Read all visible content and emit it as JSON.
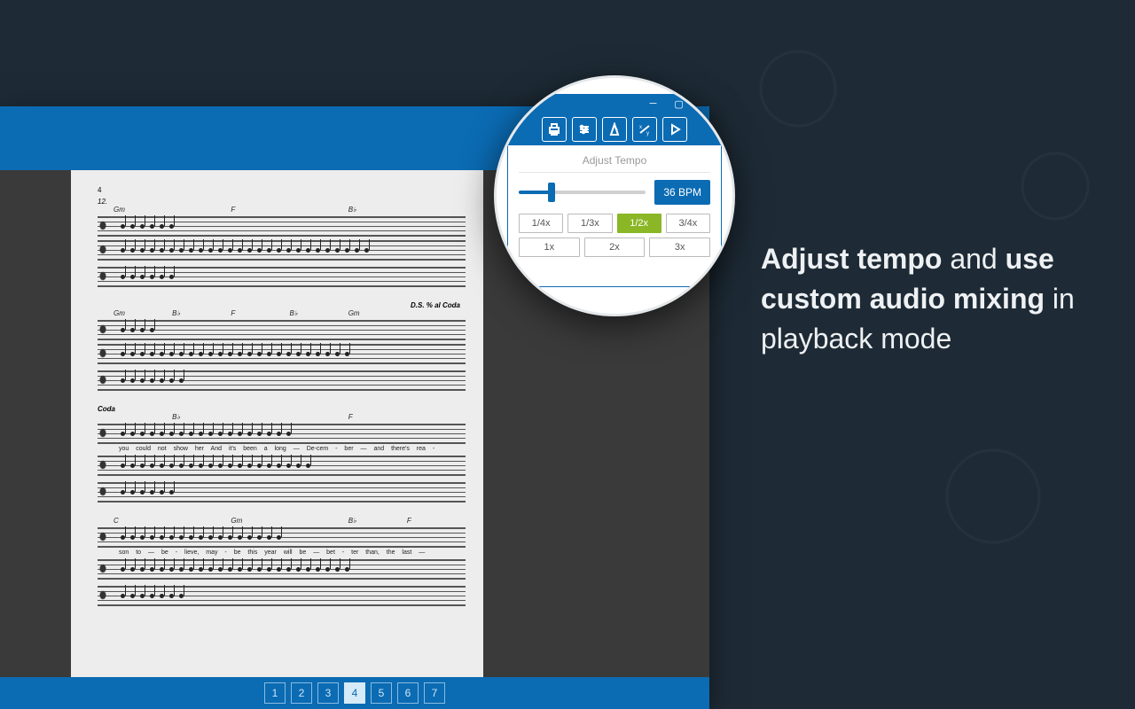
{
  "sheet": {
    "page_label": "4",
    "blocks": [
      {
        "rehearsal": "12.",
        "chords": [
          "Gm",
          "",
          "F",
          "",
          "B♭",
          ""
        ],
        "lyrics": ""
      },
      {
        "direction": "D.S. % al Coda",
        "chords": [
          "Gm",
          "B♭",
          "F",
          "B♭",
          "Gm",
          ""
        ],
        "lyrics": ""
      },
      {
        "rehearsal": "Coda",
        "chords": [
          "",
          "B♭",
          "",
          "",
          "F",
          ""
        ],
        "lyrics": "you could not show her  And it's been a   long —  De-cem - ber —  and there's  rea -"
      },
      {
        "chords": [
          "C",
          "",
          "Gm",
          "",
          "B♭",
          "F"
        ],
        "lyrics": "son  to —  be - lieve,   may - be  this  year  will  be —  bet - ter than,  the  last —"
      }
    ]
  },
  "pages": {
    "list": [
      "1",
      "2",
      "3",
      "4",
      "5",
      "6",
      "7"
    ],
    "active": "4"
  },
  "tempo_panel": {
    "title": "Adjust Tempo",
    "bpm": "36 BPM",
    "multipliers_row1": [
      "1/4x",
      "1/3x",
      "1/2x",
      "3/4x"
    ],
    "multipliers_row2": [
      "1x",
      "2x",
      "3x"
    ],
    "active_multiplier": "1/2x"
  },
  "promo": {
    "part1_bold": "Adjust tempo",
    "part2": " and ",
    "part3_bold": "use custom audio mixing",
    "part4": " in playback mode"
  },
  "icons": [
    "print",
    "sliders",
    "metronome",
    "fraction",
    "play"
  ]
}
